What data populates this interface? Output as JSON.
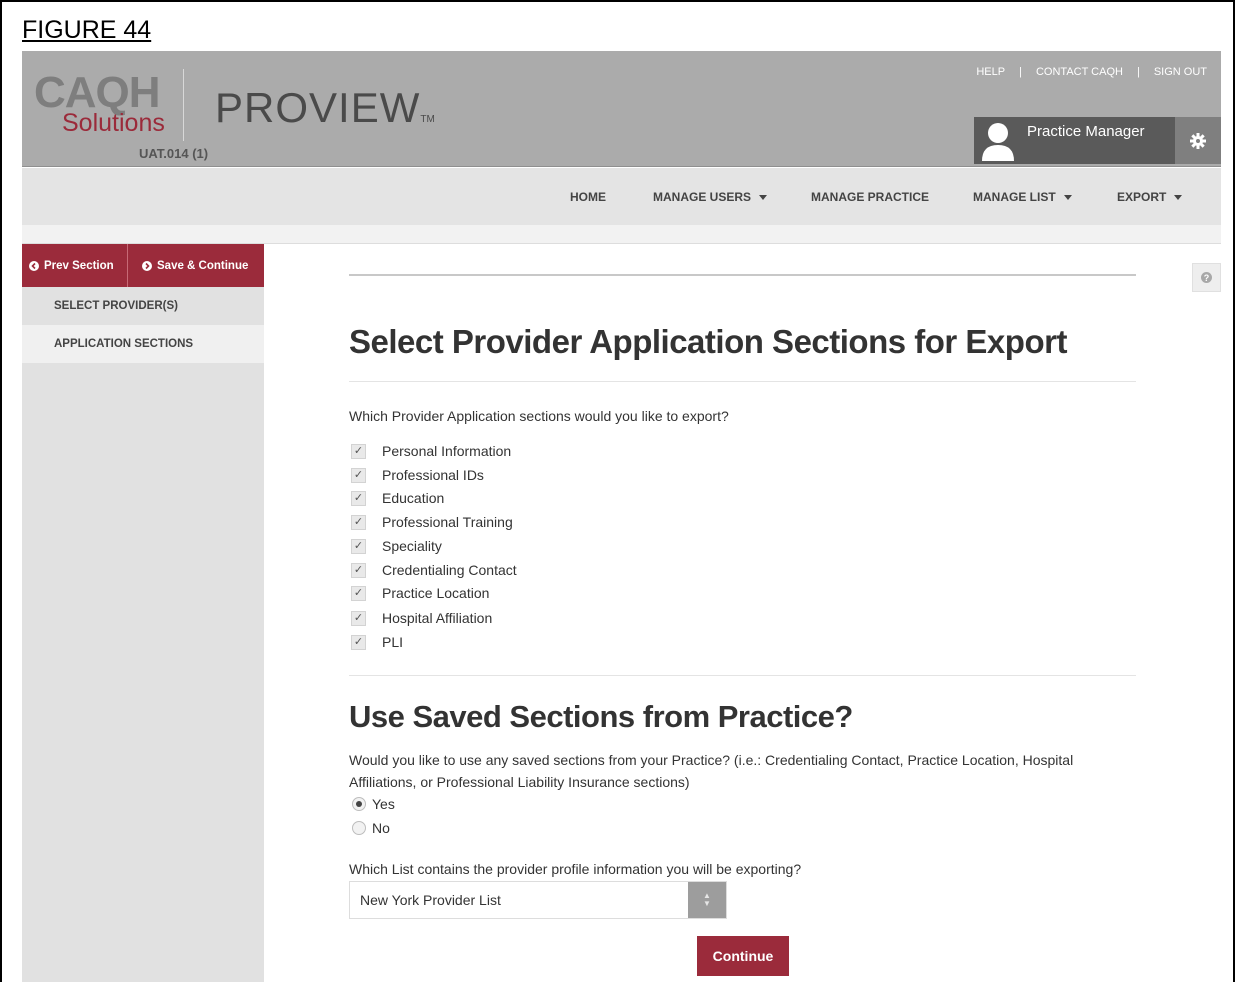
{
  "figure_label": "FIGURE 44",
  "header": {
    "logo_caqh": "CAQH",
    "logo_solutions": "Solutions",
    "logo_proview": "PROVIEW",
    "logo_tm": "TM",
    "env_label": "UAT.014 (1)",
    "top_links": [
      "HELP",
      "CONTACT CAQH",
      "SIGN OUT"
    ],
    "user_name": "Practice Manager"
  },
  "nav": {
    "home": "HOME",
    "manage_users": "MANAGE USERS",
    "manage_practice": "MANAGE PRACTICE",
    "manage_list": "MANAGE LIST",
    "export": "EXPORT"
  },
  "sidebar": {
    "prev_label": "Prev Section",
    "save_label": "Save & Continue",
    "items": [
      {
        "label": "SELECT PROVIDER(S)",
        "active": false
      },
      {
        "label": "APPLICATION SECTIONS",
        "active": true
      }
    ]
  },
  "main": {
    "title": "Select Provider Application Sections for Export",
    "question": "Which Provider Application sections would you like to export?",
    "sections": [
      "Personal Information",
      "Professional IDs",
      "Education",
      "Professional Training",
      "Speciality",
      "Credentialing Contact",
      "Practice Location",
      "Hospital Affiliation",
      "PLI"
    ],
    "saved_title": "Use Saved Sections from Practice?",
    "saved_question": "Would you like to use any saved sections from your Practice? (i.e.: Credentialing Contact, Practice Location, Hospital Affiliations, or Professional Liability Insurance sections)",
    "radio_yes": "Yes",
    "radio_no": "No",
    "radio_selected": "Yes",
    "list_question": "Which List contains the provider profile information you will be exporting?",
    "list_value": "New York Provider List",
    "continue_label": "Continue"
  },
  "colors": {
    "accent": "#9b2b3b",
    "header_bg": "#ababab",
    "nav_bg": "#e4e4e4",
    "sidebar_bg": "#e1e1e1"
  }
}
